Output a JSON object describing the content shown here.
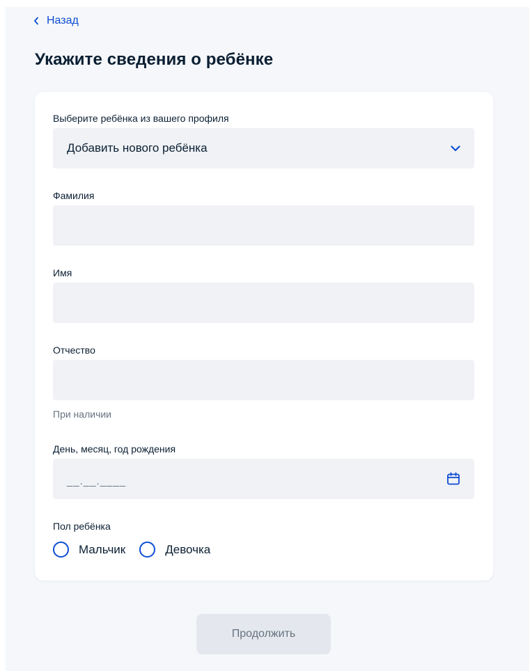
{
  "nav": {
    "back_label": "Назад"
  },
  "page": {
    "title": "Укажите сведения о ребёнке"
  },
  "form": {
    "child_select": {
      "label": "Выберите ребёнка из вашего профиля",
      "value": "Добавить нового ребёнка"
    },
    "surname": {
      "label": "Фамилия",
      "value": ""
    },
    "name": {
      "label": "Имя",
      "value": ""
    },
    "patronymic": {
      "label": "Отчество",
      "value": "",
      "hint": "При наличии"
    },
    "birth_date": {
      "label": "День, месяц, год рождения",
      "mask": "__.__.____"
    },
    "gender": {
      "label": "Пол ребёнка",
      "options": [
        "Мальчик",
        "Девочка"
      ]
    }
  },
  "actions": {
    "continue_label": "Продолжить"
  },
  "colors": {
    "accent": "#0d4cd3",
    "text": "#0b1f33",
    "muted": "#66727f",
    "field_bg": "#f0f2f5",
    "page_bg": "#f5f7fa",
    "button_disabled_bg": "#e4e8ee"
  },
  "icons": {
    "back": "chevron-left-icon",
    "select": "chevron-down-icon",
    "date": "calendar-icon"
  }
}
